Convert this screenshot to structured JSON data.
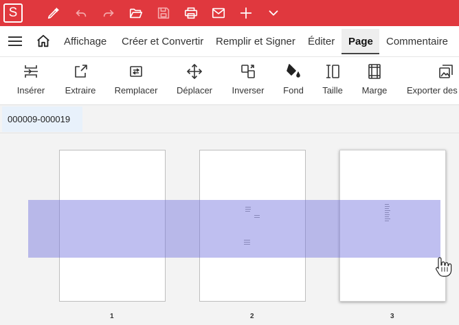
{
  "app": {
    "logo_letter": "S",
    "accent": "#e0383e"
  },
  "quick_toolbar": [
    {
      "name": "pen-icon"
    },
    {
      "name": "undo-icon"
    },
    {
      "name": "redo-icon"
    },
    {
      "name": "open-folder-icon"
    },
    {
      "name": "save-icon"
    },
    {
      "name": "print-icon"
    },
    {
      "name": "mail-icon"
    },
    {
      "name": "plus-icon"
    },
    {
      "name": "chevron-down-icon"
    }
  ],
  "menu": {
    "items": [
      {
        "label": "Affichage"
      },
      {
        "label": "Créer et Convertir"
      },
      {
        "label": "Remplir et Signer"
      },
      {
        "label": "Éditer"
      },
      {
        "label": "Page"
      },
      {
        "label": "Commentaire"
      }
    ],
    "active": "Page"
  },
  "ribbon": {
    "tools": [
      {
        "label": "Insérer",
        "icon": "insert-icon"
      },
      {
        "label": "Extraire",
        "icon": "extract-icon"
      },
      {
        "label": "Remplacer",
        "icon": "replace-icon"
      },
      {
        "label": "Déplacer",
        "icon": "move-icon"
      },
      {
        "label": "Inverser",
        "icon": "reverse-icon"
      },
      {
        "label": "Fond",
        "icon": "fill-icon"
      },
      {
        "label": "Taille",
        "icon": "size-icon"
      },
      {
        "label": "Marge",
        "icon": "margin-icon"
      },
      {
        "label": "Exporter des",
        "icon": "export-images-icon"
      }
    ]
  },
  "file_tab": {
    "label": "000009-000019"
  },
  "pages": [
    {
      "number": "1"
    },
    {
      "number": "2"
    },
    {
      "number": "3",
      "selected": true
    }
  ],
  "selection_color": "#7070de"
}
